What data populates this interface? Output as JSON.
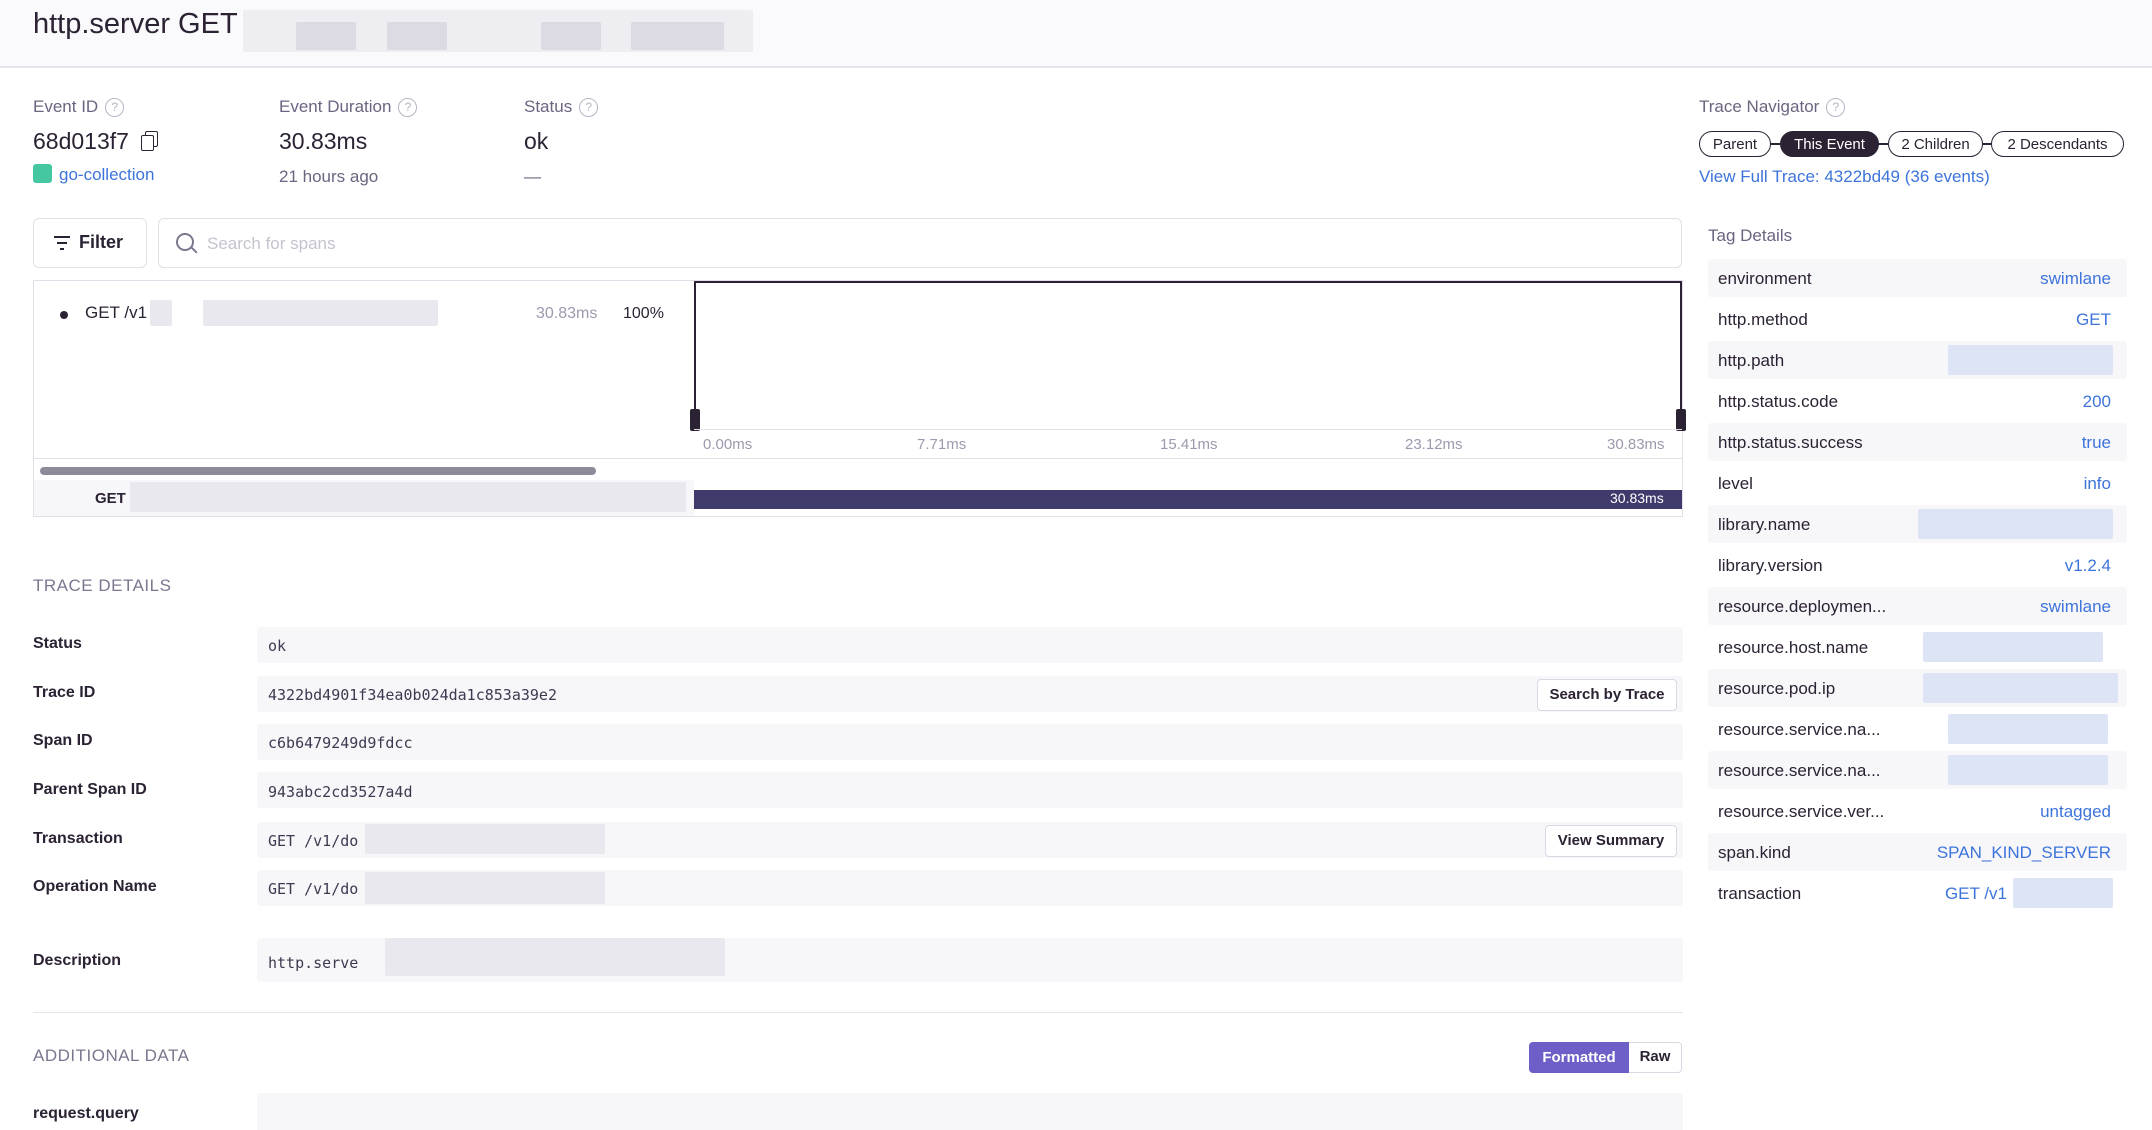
{
  "header": {
    "title": "http.server GET"
  },
  "event": {
    "id_label": "Event ID",
    "id_value": "68d013f7",
    "project": "go-collection",
    "duration_label": "Event Duration",
    "duration_value": "30.83ms",
    "duration_sub": "21 hours ago",
    "status_label": "Status",
    "status_value": "ok",
    "status_sub": "—"
  },
  "trace_navigator": {
    "label": "Trace Navigator",
    "pills": [
      "Parent",
      "This Event",
      "2 Children",
      "2 Descendants"
    ],
    "full_trace_link": "View Full Trace: 4322bd49 (36 events)"
  },
  "toolbar": {
    "filter_label": "Filter",
    "search_placeholder": "Search for spans"
  },
  "waterfall": {
    "span_name": "GET /v1",
    "span_duration": "30.83ms",
    "span_percent": "100%",
    "ticks": [
      "0.00ms",
      "7.71ms",
      "15.41ms",
      "23.12ms",
      "30.83ms"
    ],
    "bar_label": "GET",
    "bar_duration": "30.83ms"
  },
  "trace_details": {
    "title": "TRACE DETAILS",
    "rows": [
      {
        "label": "Status",
        "value": "ok"
      },
      {
        "label": "Trace ID",
        "value": "4322bd4901f34ea0b024da1c853a39e2",
        "button": "Search by Trace"
      },
      {
        "label": "Span ID",
        "value": "c6b6479249d9fdcc"
      },
      {
        "label": "Parent Span ID",
        "value": "943abc2cd3527a4d"
      },
      {
        "label": "Transaction",
        "value": "GET /v1/do",
        "button": "View Summary"
      },
      {
        "label": "Operation Name",
        "value": "GET /v1/do"
      },
      {
        "label": "Description",
        "value": "http.serve"
      }
    ]
  },
  "additional_data": {
    "title": "ADDITIONAL DATA",
    "toggle": [
      "Formatted",
      "Raw"
    ],
    "first_key": "request.query"
  },
  "tag_details": {
    "title": "Tag Details",
    "tags": [
      {
        "key": "environment",
        "value": "swimlane"
      },
      {
        "key": "http.method",
        "value": "GET"
      },
      {
        "key": "http.path",
        "value": ""
      },
      {
        "key": "http.status.code",
        "value": "200"
      },
      {
        "key": "http.status.success",
        "value": "true"
      },
      {
        "key": "level",
        "value": "info"
      },
      {
        "key": "library.name",
        "value": ""
      },
      {
        "key": "library.version",
        "value": "v1.2.4"
      },
      {
        "key": "resource.deploymen...",
        "value": "swimlane"
      },
      {
        "key": "resource.host.name",
        "value": ""
      },
      {
        "key": "resource.pod.ip",
        "value": ""
      },
      {
        "key": "resource.service.na...",
        "value": ""
      },
      {
        "key": "resource.service.na...",
        "value": ""
      },
      {
        "key": "resource.service.ver...",
        "value": "untagged"
      },
      {
        "key": "span.kind",
        "value": "SPAN_KIND_SERVER"
      },
      {
        "key": "transaction",
        "value": "GET /v1"
      }
    ]
  }
}
